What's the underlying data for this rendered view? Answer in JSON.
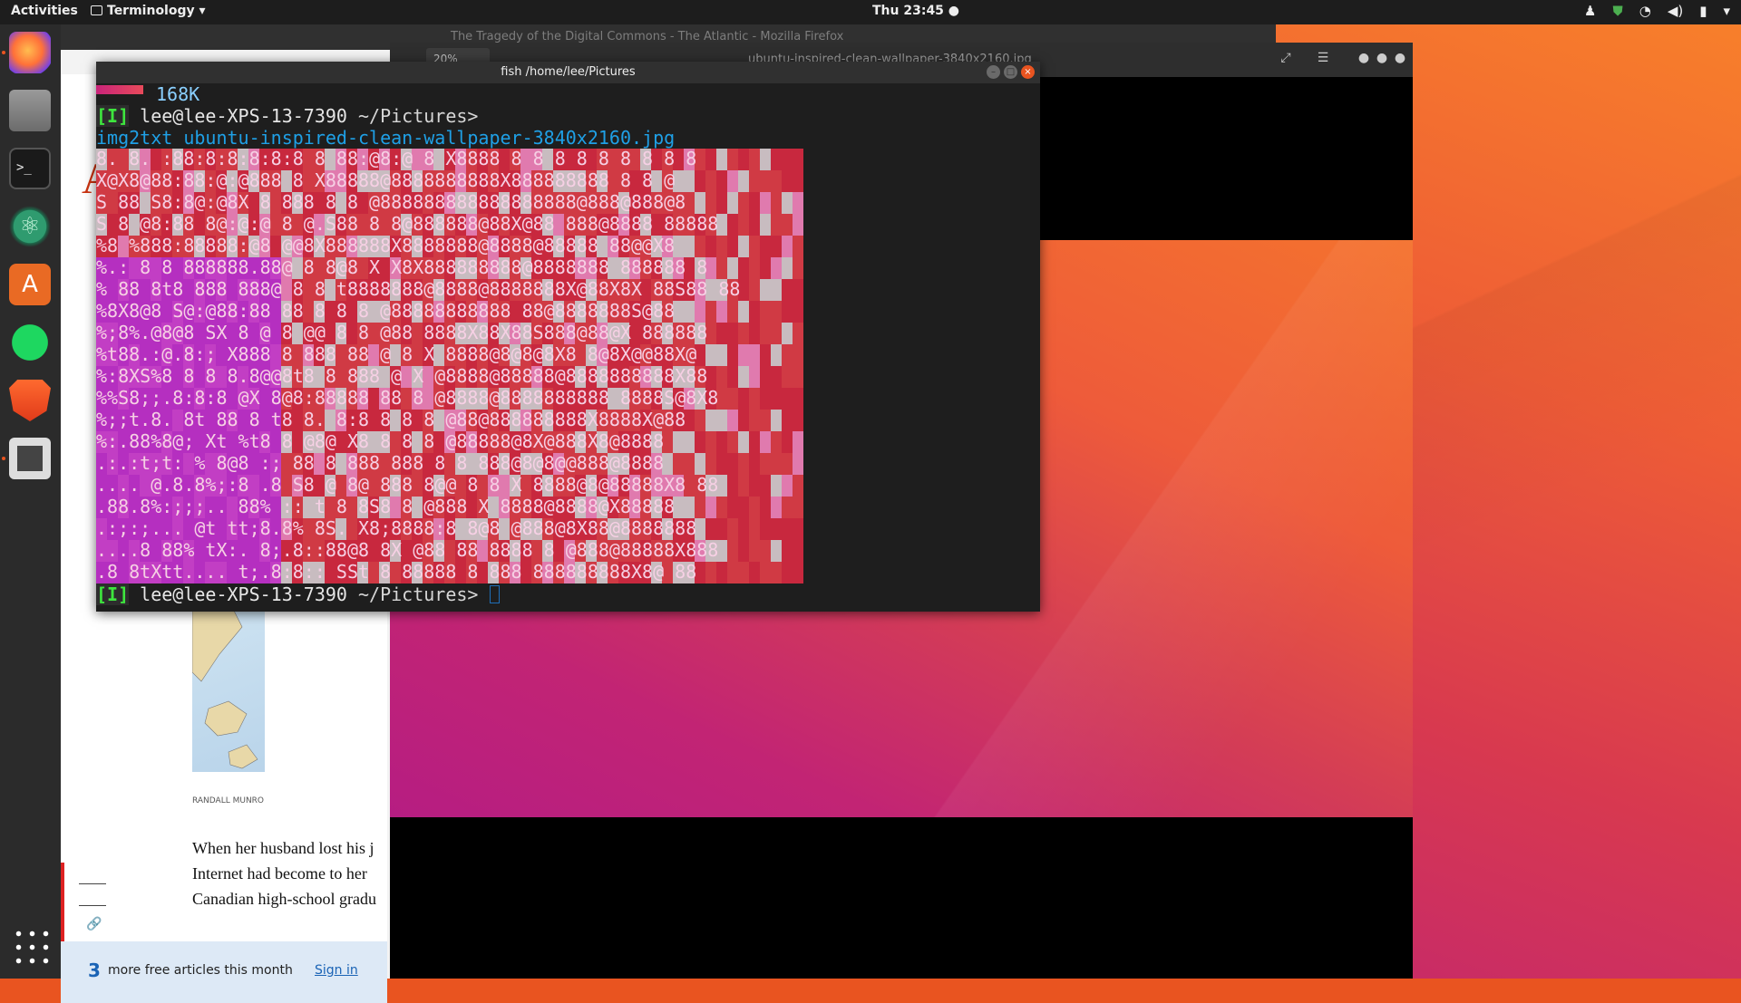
{
  "topbar": {
    "activities": "Activities",
    "app_menu": "Terminology",
    "clock": "Thu 23:45"
  },
  "dock": {
    "items": [
      "firefox-icon",
      "files-icon",
      "terminal-icon",
      "atom-icon",
      "software-icon",
      "spotify-icon",
      "brave-icon",
      "terminology-icon",
      "app-grid-icon"
    ]
  },
  "firefox": {
    "title": "The Tragedy of the Digital Commons - The Atlantic - Mozilla Firefox",
    "map_credit": "RANDALL MUNRO",
    "paragraph": [
      "When her husband lost his j",
      "Internet had become to her",
      "Canadian high-school gradu"
    ],
    "promo": {
      "count": "3",
      "text": "more free articles this month",
      "signin": "Sign in"
    }
  },
  "viewer": {
    "title": "ubuntu-inspired-clean-wallpaper-3840x2160.jpg",
    "zoom": "20%"
  },
  "terminal": {
    "title": "fish /home/lee/Pictures",
    "size_output": "168K",
    "mode": "[I]",
    "user_host": "lee@lee-XPS-13-7390",
    "cwd": "~/Pictures",
    "prompt_symbol": ">",
    "command": "img2txt ubuntu-inspired-clean-wallpaper-3840x2160.jpg",
    "art_rows": [
      "8. 8. :88:8:8:8:8:8 8 88:@8:@ 8 X8888 8 8 8 8 8 8 8 8 8",
      "X@X8@88:88:@:@888 8 X88888@8888888888X888888888 8 8 @",
      "S 88 S8:8@:@8X 8 888 8 8 @888888888888888888@888@888@8",
      "S 8 @8:88 8@:@:@ 8 @.S88 8 8@888888@88X@88 888@8888 88888",
      "%8 %888:88888:@8 @@8X888888X8888888@8888@88888 88@@X8",
      "%.: 8 8 888888.88@ 8 8@8 X X8X888888888@8888888 888888 8",
      "% 88 8t8 888 888@ 8 8 t8888888@8888@8888888X@88X8X 88S88 88",
      "%8X8@8 S@:@88:88 88 8 8 8 @88888888888 88@8888888S@88",
      "%;8%.@8@8 SX 8 @ 8 @@ 8 8 @88 8888X88X88S888@88@X 888888",
      "%t88.:@.8:; X888 8 888 88 @ 8 X 8888@8@8@8X8 8@8X@@88X@",
      "%:8XS%8 8 8 8.8@@8t8 8 888 @ X @8888@88888@8888888888X88",
      "%%S8;;.8:8:8 @X 8@8:88888 88 8 @8888@8888888888 8888S@8X8",
      "%;;t.8. 8t 88 8 t8 8. 8:8 8 8 8 @88@888888888X8888X@88",
      "%:.88%8@; Xt %t8 8 @8@ X8 8 8 8 @88888@8X@888X8@8888",
      ".:.:t;t: % 8@8 :; 88 8 888 888 8 8 888@8@8@@888@8888",
      " .... @.8.8%;:8 .8 S8 @ 8@ 888 8@@ 8 8 X 8888@8@88888X8 88",
      " .88.8%:;;;.. 88% :: t 8 8S8 8 @888 X 8888@8888@X88888",
      " .:;:;... @t tt;8.8% 8S. X8;8888:8 8@8 @888@8X88@8888888",
      " ....8 88% tX:. 8;.8::88@8 8X @88 88 8888 8 @888@88888X888",
      " .8 8tXtt.... t;.8:8:: SSt 8 88888 8 888 888888888X8@ 88"
    ]
  }
}
